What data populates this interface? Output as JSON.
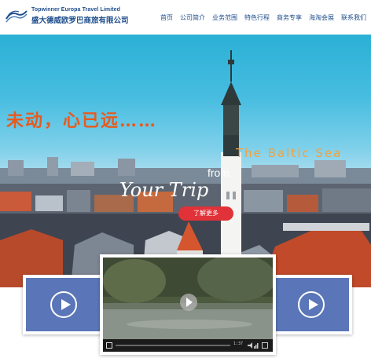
{
  "brand": {
    "name_en": "Topwinner Europa Travel Limited",
    "name_cn": "盛大德威欧罗巴商旅有限公司",
    "logo_icon": "wave-logo-icon"
  },
  "nav": {
    "items": [
      {
        "label": "首页"
      },
      {
        "label": "公司简介"
      },
      {
        "label": "业务范围"
      },
      {
        "label": "特色行程"
      },
      {
        "label": "商务专享"
      },
      {
        "label": "海淘会展"
      },
      {
        "label": "联系我们"
      }
    ]
  },
  "hero": {
    "slogan_cn": "未动，心已远……",
    "baltic": "The Baltic Sea",
    "from": "from",
    "your_trip": "Your Trip",
    "more_button": "了解更多"
  },
  "videos": {
    "left_icon": "play-icon",
    "right_icon": "play-icon",
    "center": {
      "time": "1:37",
      "progress": 0.0,
      "play_icon": "play-icon",
      "volume_icon": "volume-icon",
      "fullscreen_icon": "fullscreen-icon"
    }
  },
  "colors": {
    "brand_blue": "#1e4d8c",
    "accent_red": "#e03238",
    "slogan_orange": "#e85a1e",
    "card_blue": "#5a76b8"
  }
}
